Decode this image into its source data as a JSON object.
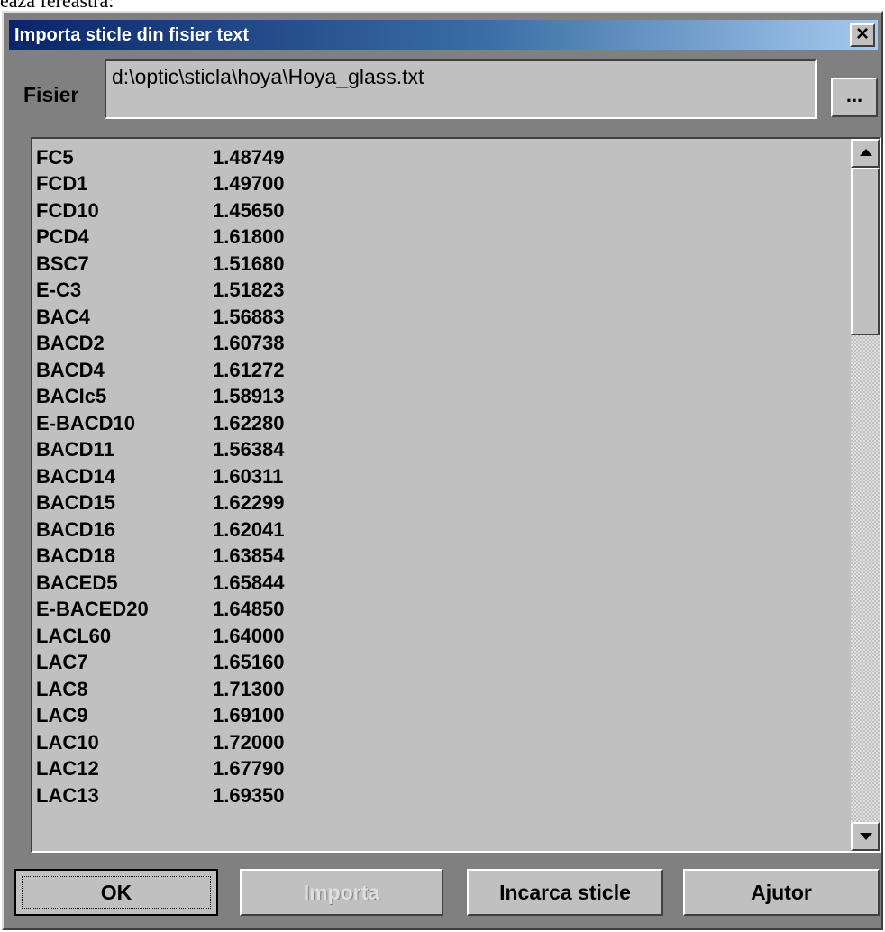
{
  "page_top_text": "eaza fereastra:",
  "window": {
    "title": "Importa sticle din fisier text",
    "close_symbol": "×"
  },
  "file": {
    "label": "Fisier",
    "path": "d:\\optic\\sticla\\hoya\\Hoya_glass.txt",
    "browse_label": "..."
  },
  "glasses": [
    {
      "name": "FC5",
      "index": "1.48749"
    },
    {
      "name": "FCD1",
      "index": "1.49700"
    },
    {
      "name": "FCD10",
      "index": "1.45650"
    },
    {
      "name": "PCD4",
      "index": "1.61800"
    },
    {
      "name": "BSC7",
      "index": "1.51680"
    },
    {
      "name": "E-C3",
      "index": "1.51823"
    },
    {
      "name": "BAC4",
      "index": "1.56883"
    },
    {
      "name": "BACD2",
      "index": "1.60738"
    },
    {
      "name": "BACD4",
      "index": "1.61272"
    },
    {
      "name": "BACIc5",
      "index": "1.58913"
    },
    {
      "name": "E-BACD10",
      "index": "1.62280"
    },
    {
      "name": "BACD11",
      "index": "1.56384"
    },
    {
      "name": "BACD14",
      "index": "1.60311"
    },
    {
      "name": "BACD15",
      "index": "1.62299"
    },
    {
      "name": "BACD16",
      "index": "1.62041"
    },
    {
      "name": "BACD18",
      "index": "1.63854"
    },
    {
      "name": "BACED5",
      "index": "1.65844"
    },
    {
      "name": "E-BACED20",
      "index": "1.64850"
    },
    {
      "name": "LACL60",
      "index": "1.64000"
    },
    {
      "name": "LAC7",
      "index": "1.65160"
    },
    {
      "name": "LAC8",
      "index": "1.71300"
    },
    {
      "name": "LAC9",
      "index": "1.69100"
    },
    {
      "name": "LAC10",
      "index": "1.72000"
    },
    {
      "name": "LAC12",
      "index": "1.67790"
    },
    {
      "name": "LAC13",
      "index": "1.69350"
    }
  ],
  "buttons": {
    "ok": "OK",
    "import": "Importa",
    "load": "Incarca sticle",
    "help": "Ajutor"
  },
  "colors": {
    "window_bg": "#808080",
    "control_bg": "#c0c0c0",
    "title_start": "#0a246a",
    "title_end": "#a6caf0"
  }
}
